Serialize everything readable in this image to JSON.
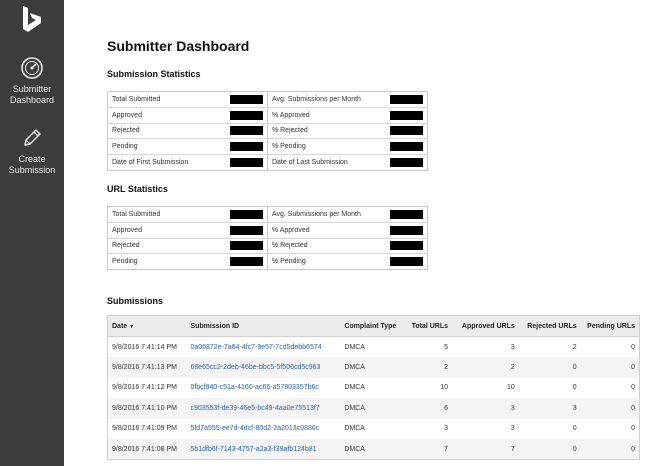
{
  "sidebar": {
    "items": [
      {
        "label_line1": "Submitter",
        "label_line2": "Dashboard",
        "icon": "gauge-icon"
      },
      {
        "label_line1": "Create",
        "label_line2": "Submission",
        "icon": "pencil-icon"
      }
    ],
    "logo": "bing-logo-icon"
  },
  "page": {
    "title": "Submitter Dashboard"
  },
  "submission_statistics": {
    "title": "Submission Statistics",
    "rows": [
      {
        "left_label": "Total Submitted",
        "right_label": "Avg. Submissions per Month"
      },
      {
        "left_label": "Approved",
        "right_label": "% Approved"
      },
      {
        "left_label": "Rejected",
        "right_label": "% Rejected"
      },
      {
        "left_label": "Pending",
        "right_label": "% Pending"
      },
      {
        "left_label": "Date of First Submission",
        "right_label": "Date of Last Submission"
      }
    ]
  },
  "url_statistics": {
    "title": "URL Statistics",
    "rows": [
      {
        "left_label": "Total Submitted",
        "right_label": "Avg. Submissions per Month"
      },
      {
        "left_label": "Approved",
        "right_label": "% Approved"
      },
      {
        "left_label": "Rejected",
        "right_label": "% Rejected"
      },
      {
        "left_label": "Pending",
        "right_label": "% Pending"
      }
    ]
  },
  "submissions": {
    "title": "Submissions",
    "columns": [
      "Date",
      "Submission ID",
      "Complaint Type",
      "Total URLs",
      "Approved URLs",
      "Rejected URLs",
      "Pending URLs"
    ],
    "sort_indicator": "▼",
    "rows": [
      {
        "date": "9/8/2016 7:41:14 PM",
        "id": "0a06872e-7a84-4fc7-9e57-7cd5debb6574",
        "type": "DMCA",
        "total": "5",
        "approved": "3",
        "rejected": "2",
        "pending": "0"
      },
      {
        "date": "9/8/2016 7:41:13 PM",
        "id": "68e65cc2-2deb-46be-bbc5-5f506cd5c963",
        "type": "DMCA",
        "total": "2",
        "approved": "2",
        "rejected": "0",
        "pending": "0"
      },
      {
        "date": "9/8/2016 7:41:12 PM",
        "id": "0fbcf940-c51a-4160-ac66-a57803357b6c",
        "type": "DMCA",
        "total": "10",
        "approved": "10",
        "rejected": "0",
        "pending": "0"
      },
      {
        "date": "9/8/2016 7:41:10 PM",
        "id": "c903553f-de39-46e5-bc49-4aa0e75513f7",
        "type": "DMCA",
        "total": "6",
        "approved": "3",
        "rejected": "3",
        "pending": "0"
      },
      {
        "date": "9/8/2016 7:41:09 PM",
        "id": "5fd7a555-ee7d-4dcf-80d2-2a2013c0886c",
        "type": "DMCA",
        "total": "3",
        "approved": "3",
        "rejected": "0",
        "pending": "0"
      },
      {
        "date": "9/8/2016 7:41:08 PM",
        "id": "5b1dfb6f-7143-4757-a2a3-f39afb124b81",
        "type": "DMCA",
        "total": "7",
        "approved": "7",
        "rejected": "0",
        "pending": "0"
      }
    ]
  },
  "colors": {
    "sidebar_bg": "#3d3d3d",
    "link": "#2a5fb0",
    "redaction": "#000000"
  }
}
